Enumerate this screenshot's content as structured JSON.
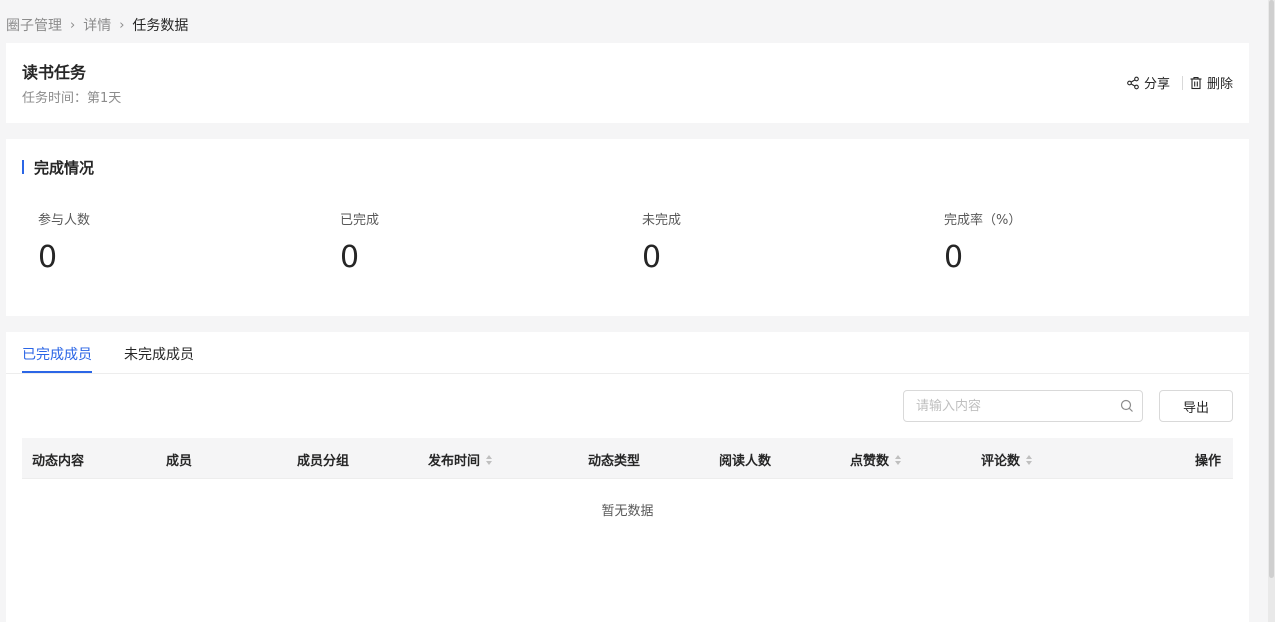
{
  "breadcrumb": {
    "items": [
      "圈子管理",
      "详情"
    ],
    "current": "任务数据",
    "separator": ">"
  },
  "task": {
    "title": "读书任务",
    "time_label": "任务时间：第1天"
  },
  "actions": {
    "share": "分享",
    "delete": "删除"
  },
  "stats": {
    "title": "完成情况",
    "items": [
      {
        "label": "参与人数",
        "value": "0"
      },
      {
        "label": "已完成",
        "value": "0"
      },
      {
        "label": "未完成",
        "value": "0"
      },
      {
        "label": "完成率（%）",
        "value": "0"
      }
    ]
  },
  "tabs": [
    {
      "label": "已完成成员",
      "active": true
    },
    {
      "label": "未完成成员",
      "active": false
    }
  ],
  "search": {
    "placeholder": "请输入内容",
    "value": ""
  },
  "export_label": "导出",
  "table": {
    "columns": [
      {
        "label": "动态内容",
        "sortable": false
      },
      {
        "label": "成员",
        "sortable": false
      },
      {
        "label": "成员分组",
        "sortable": false
      },
      {
        "label": "发布时间",
        "sortable": true
      },
      {
        "label": "动态类型",
        "sortable": false
      },
      {
        "label": "阅读人数",
        "sortable": false
      },
      {
        "label": "点赞数",
        "sortable": true
      },
      {
        "label": "评论数",
        "sortable": true
      },
      {
        "label": "操作",
        "sortable": false
      }
    ],
    "rows": [],
    "empty_text": "暂无数据"
  },
  "colors": {
    "accent": "#2b66e6",
    "background": "#f5f5f6"
  },
  "icons": {
    "share": "share-icon",
    "delete": "trash-icon",
    "search": "search-icon",
    "separator": "chevron-right-icon"
  }
}
